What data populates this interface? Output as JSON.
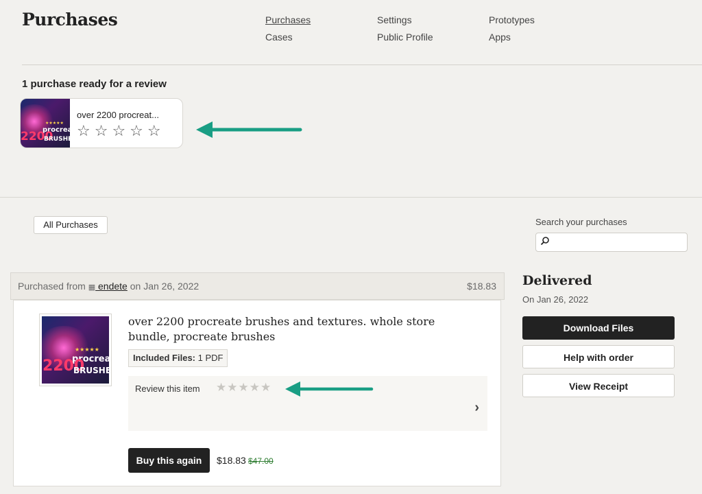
{
  "header": {
    "title": "Purchases",
    "nav": [
      [
        {
          "label": "Purchases",
          "active": true
        },
        {
          "label": "Cases"
        }
      ],
      [
        {
          "label": "Settings"
        },
        {
          "label": "Public Profile"
        }
      ],
      [
        {
          "label": "Prototypes"
        },
        {
          "label": "Apps"
        }
      ]
    ]
  },
  "review_prompt": {
    "heading": "1 purchase ready for a review",
    "item_title": "over 2200 procreat...",
    "stars": "☆☆☆☆☆"
  },
  "thumbnail": {
    "number": "2200",
    "line1": "procreat",
    "line2": "BRUSHES",
    "rating_stars": "★★★★★"
  },
  "filter": {
    "label": "All Purchases"
  },
  "search": {
    "label": "Search your purchases",
    "placeholder": "",
    "icon": "search-icon"
  },
  "order": {
    "purchased_from_prefix": "Purchased from ",
    "shop_name": " endete",
    "date_text": " on Jan 26, 2022",
    "total": "$18.83",
    "item_title": "over 2200 procreate brushes and textures. whole store bundle, procreate brushes",
    "files_label": "Included Files:",
    "files_value": " 1 PDF",
    "review_label": "Review this item",
    "review_stars": "★★★★★",
    "buy_again_label": "Buy this again",
    "price": "$18.83",
    "original_price": "$47.00"
  },
  "status": {
    "title": "Delivered",
    "date": "On Jan 26, 2022",
    "download_label": "Download Files",
    "help_label": "Help with order",
    "receipt_label": "View Receipt"
  },
  "colors": {
    "accent_arrow": "#1a9e84",
    "dark_button": "#222222",
    "discount_price": "#2f7d32"
  }
}
